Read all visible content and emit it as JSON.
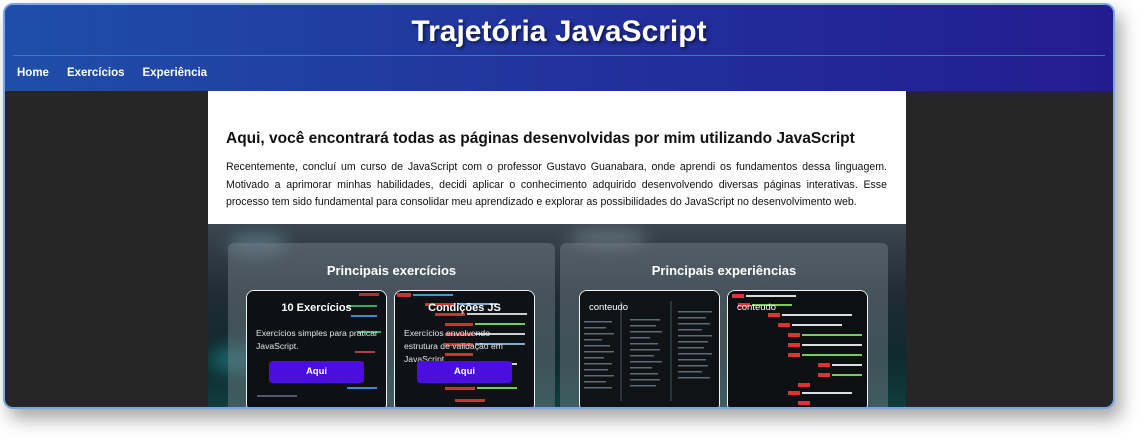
{
  "header": {
    "title": "Trajetória JavaScript",
    "nav": [
      "Home",
      "Exercícios",
      "Experiência"
    ]
  },
  "intro": {
    "heading": "Aqui, você encontrará todas as páginas desenvolvidas por mim utilizando JavaScript",
    "text": "Recentemente, concluí um curso de JavaScript com o professor Gustavo Guanabara, onde aprendi os fundamentos dessa linguagem. Motivado a aprimorar minhas habilidades, decidi aplicar o conhecimento adquirido desenvolvendo diversas páginas interativas. Esse processo tem sido fundamental para consolidar meu aprendizado e explorar as possibilidades do JavaScript no desenvolvimento web."
  },
  "exercises": {
    "title": "Principais exercícios",
    "cards": [
      {
        "title": "10 Exercícios",
        "desc": "Exercícios simples para praticar JavaScript.",
        "button": "Aqui"
      },
      {
        "title": "Condições JS",
        "desc": "Exercícios envolvendo estrutura de validação em JavaScript",
        "button": "Aqui"
      }
    ]
  },
  "experiences": {
    "title": "Principais experiências",
    "cards": [
      {
        "label": "conteudo"
      },
      {
        "label": "conteudo"
      }
    ]
  },
  "colors": {
    "header_start": "#1e4fa8",
    "header_end": "#231c90",
    "button": "#4b0ee0",
    "frame_border": "#7aa6e6"
  }
}
